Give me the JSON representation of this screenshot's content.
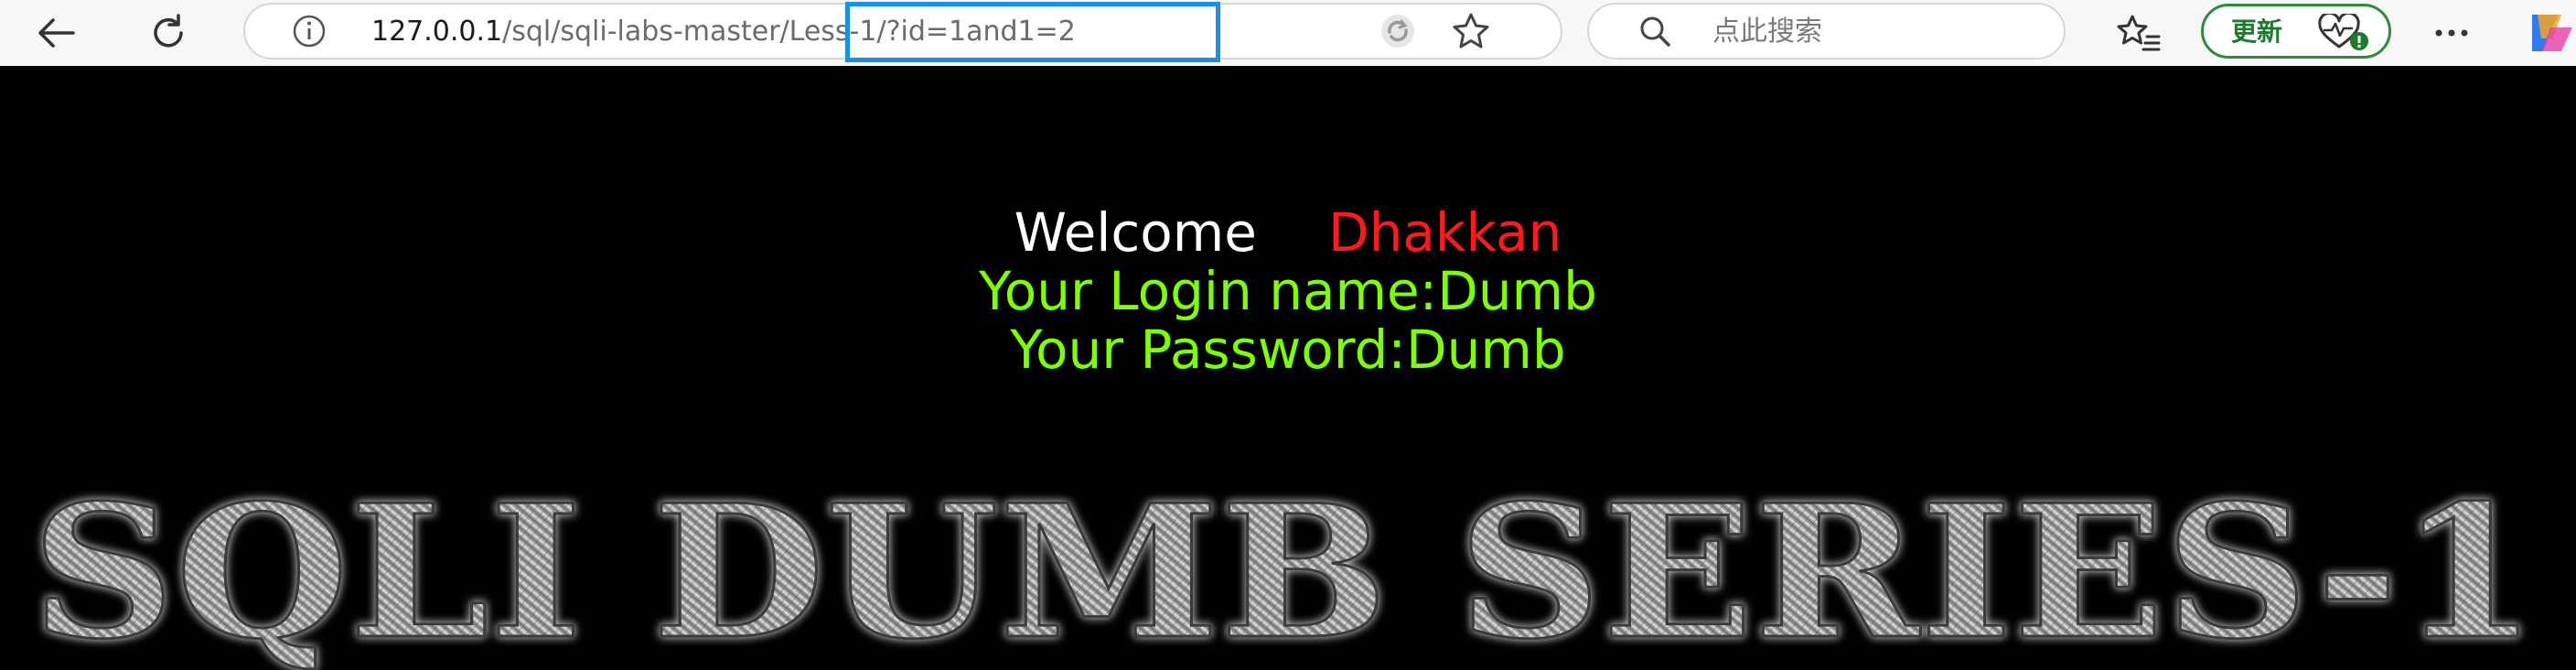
{
  "browser": {
    "back_icon": "arrow-left-icon",
    "reload_icon": "refresh-icon",
    "info_icon": "info-icon",
    "url_host": "127.0.0.1",
    "url_path": "/sql/sqli-labs-master/",
    "url_query": "Less-1/?id=1and1=2",
    "highlight_color": "#1a8fe6",
    "search_placeholder": "点此搜索",
    "update_label": "更新",
    "more_label": "···"
  },
  "page": {
    "welcome": "Welcome",
    "name": "Dhakkan",
    "login_line": "Your Login name:Dumb",
    "password_line": "Your Password:Dumb",
    "banner_text": "SQLI DUMB SERIES-1",
    "colors": {
      "background": "#000000",
      "welcome": "#ffffff",
      "name": "#ff1a1a",
      "info": "#7cff00"
    }
  }
}
